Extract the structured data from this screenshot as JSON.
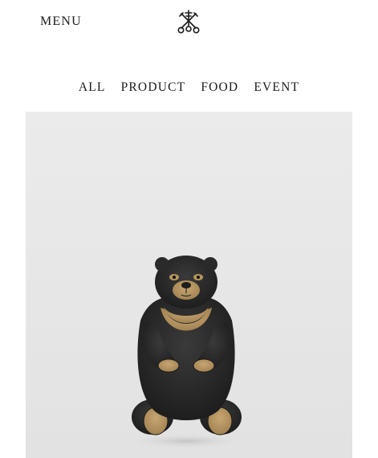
{
  "header": {
    "menu_label": "MENU",
    "logo_icon": "crossed-keys-icon"
  },
  "nav": {
    "items": [
      {
        "label": "ALL"
      },
      {
        "label": "PRODUCT"
      },
      {
        "label": "FOOD"
      },
      {
        "label": "EVENT"
      }
    ]
  },
  "hero": {
    "image": "sun-bear-plush-figure",
    "colors": {
      "background": "#e6e6e6",
      "fur": "#262626",
      "accent": "#b0915c"
    }
  }
}
